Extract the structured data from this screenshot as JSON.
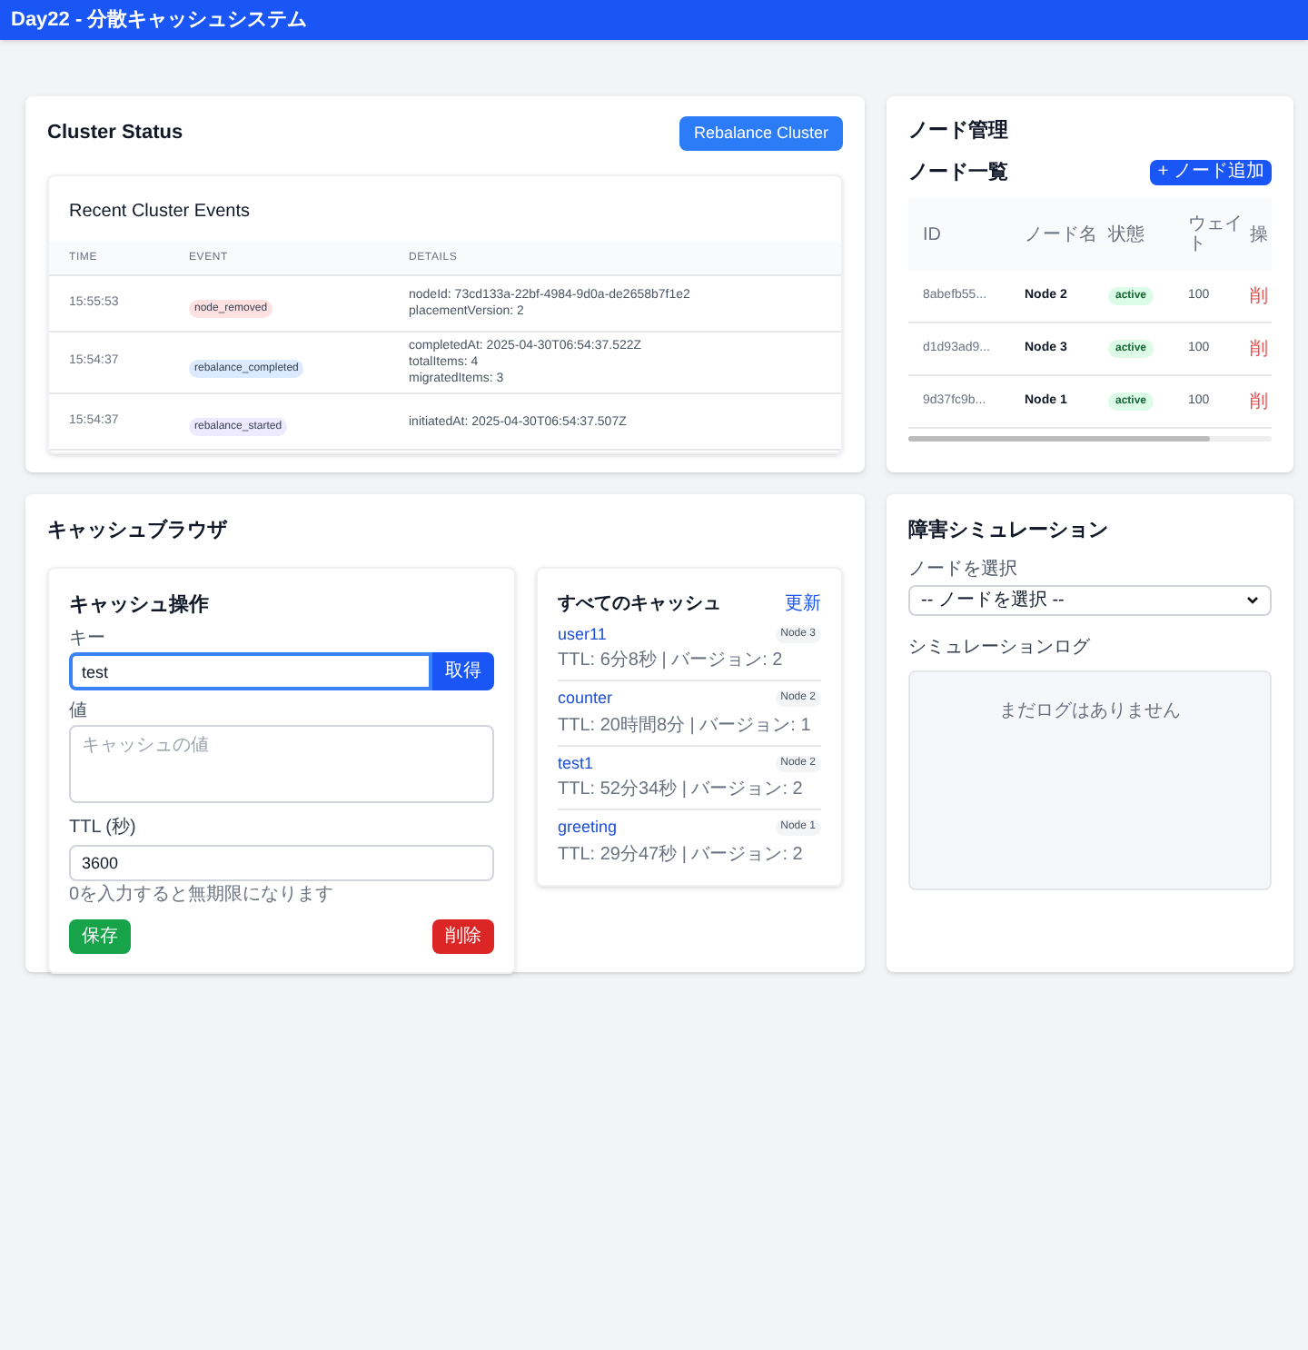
{
  "header": {
    "title": "Day22 - 分散キャッシュシステム"
  },
  "cluster_status": {
    "title": "Cluster Status",
    "button": "Rebalance Cluster",
    "events": {
      "title": "Recent Cluster Events",
      "columns": [
        "TIME",
        "EVENT",
        "DETAILS"
      ],
      "rows": [
        {
          "time": "15:55:53",
          "event": "node_removed",
          "color": "#fee2e2",
          "details": [
            "nodeId: 73cd133a-22bf-4984-9d0a-de2658b7f1e2",
            "placementVersion: 2"
          ]
        },
        {
          "time": "15:54:37",
          "event": "rebalance_completed",
          "color": "#dbeafe",
          "details": [
            "completedAt: 2025-04-30T06:54:37.522Z",
            "totalItems: 4",
            "migratedItems: 3"
          ]
        },
        {
          "time": "15:54:37",
          "event": "rebalance_started",
          "color": "#ede9fe",
          "details": [
            "initiatedAt: 2025-04-30T06:54:37.507Z"
          ]
        }
      ]
    }
  },
  "node_management": {
    "title": "ノード管理",
    "list_title": "ノード一覧",
    "add_button": "+ ノード追加",
    "columns": [
      "ID",
      "ノード名",
      "状態",
      "ウェイト",
      "操"
    ],
    "rows": [
      {
        "id": "8abefb55...",
        "name": "Node 2",
        "status": "active",
        "weight": "100",
        "action": "削"
      },
      {
        "id": "d1d93ad9...",
        "name": "Node 3",
        "status": "active",
        "weight": "100",
        "action": "削"
      },
      {
        "id": "9d37fc9b...",
        "name": "Node 1",
        "status": "active",
        "weight": "100",
        "action": "削"
      }
    ]
  },
  "cache_browser": {
    "title": "キャッシュブラウザ",
    "operation": {
      "title": "キャッシュ操作",
      "key_label": "キー",
      "key_value": "test",
      "get_button": "取得",
      "value_label": "値",
      "value_placeholder": "キャッシュの値",
      "ttl_label": "TTL (秒)",
      "ttl_value": "3600",
      "ttl_hint": "0を入力すると無期限になります",
      "save_button": "保存",
      "delete_button": "削除"
    },
    "all_caches": {
      "title": "すべてのキャッシュ",
      "refresh": "更新",
      "items": [
        {
          "key": "user11",
          "node": "Node 3",
          "meta": "TTL: 6分8秒 | バージョン: 2"
        },
        {
          "key": "counter",
          "node": "Node 2",
          "meta": "TTL: 20時間8分 | バージョン: 1"
        },
        {
          "key": "test1",
          "node": "Node 2",
          "meta": "TTL: 52分34秒 | バージョン: 2"
        },
        {
          "key": "greeting",
          "node": "Node 1",
          "meta": "TTL: 29分47秒 | バージョン: 2"
        }
      ]
    }
  },
  "failure_simulation": {
    "title": "障害シミュレーション",
    "select_label": "ノードを選択",
    "select_value": "-- ノードを選択 --",
    "log_title": "シミュレーションログ",
    "log_empty": "まだログはありません"
  }
}
